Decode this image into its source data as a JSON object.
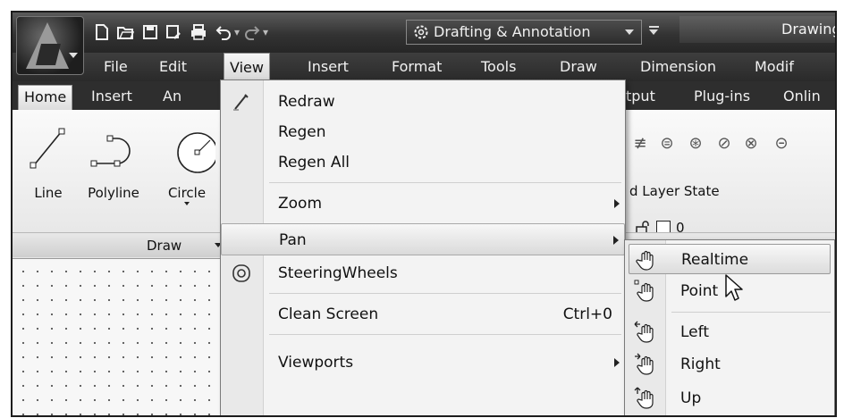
{
  "app": {
    "workspace": "Drafting & Annotation",
    "document_title": "Drawing"
  },
  "quick_access": {
    "icons": [
      "new-icon",
      "open-icon",
      "save-icon",
      "save-as-icon",
      "print-icon",
      "undo-icon",
      "redo-icon"
    ]
  },
  "menubar": {
    "items": [
      "File",
      "Edit",
      "View",
      "Insert",
      "Format",
      "Tools",
      "Draw",
      "Dimension",
      "Modif"
    ],
    "active": "View"
  },
  "ribbon": {
    "tabs": [
      "Home",
      "Insert",
      "An",
      "tput",
      "Plug-ins",
      "Onlin"
    ],
    "active_tab": "Home",
    "tools": [
      "Line",
      "Polyline",
      "Circle"
    ],
    "panel_title": "Draw",
    "layer_state": "d Layer State",
    "layer_name": "0"
  },
  "view_menu": {
    "items": [
      {
        "label": "Redraw",
        "icon": "redraw-icon"
      },
      {
        "label": "Regen"
      },
      {
        "label": "Regen All"
      },
      {
        "label": "Zoom",
        "submenu": true
      },
      {
        "label": "Pan",
        "submenu": true,
        "highlighted": true
      },
      {
        "label": "SteeringWheels",
        "icon": "steering-wheel-icon"
      },
      {
        "label": "Clean Screen",
        "shortcut": "Ctrl+0"
      },
      {
        "label": "Viewports",
        "submenu": true
      }
    ]
  },
  "pan_submenu": {
    "items": [
      {
        "label": "Realtime",
        "icon": "hand-pan-icon",
        "highlighted": true
      },
      {
        "label": "Point",
        "icon": "hand-point-icon"
      },
      {
        "label": "Left",
        "icon": "hand-left-icon"
      },
      {
        "label": "Right",
        "icon": "hand-right-icon"
      },
      {
        "label": "Up",
        "icon": "hand-up-icon"
      }
    ]
  },
  "colors": {
    "menubar_bg": "#2a2a2a",
    "menu_bg": "#f3f3f3",
    "ribbon_bg": "#eeeeee",
    "canvas_bg": "#f7f7f7"
  }
}
